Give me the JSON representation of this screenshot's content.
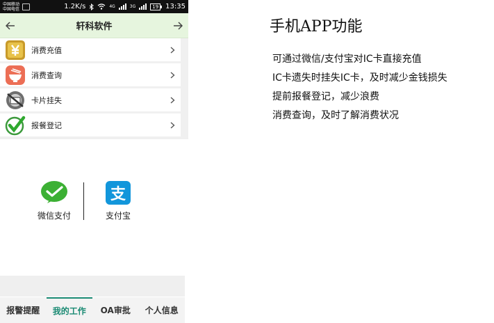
{
  "status_bar": {
    "carrier_1": "中国移动",
    "carrier_2": "中国电信",
    "speed": "1.2K/s",
    "network_1": "4G",
    "network_2": "3G",
    "battery": "19",
    "time": "13:35"
  },
  "app": {
    "title": "轩科软件",
    "menu": [
      {
        "label": "消费充值",
        "icon": "yuan-coin-icon"
      },
      {
        "label": "消费查询",
        "icon": "rice-bowl-icon"
      },
      {
        "label": "卡片挂失",
        "icon": "lost-card-icon"
      },
      {
        "label": "报餐登记",
        "icon": "check-mark-icon"
      }
    ]
  },
  "payment": {
    "wechat": "微信支付",
    "alipay": "支付宝",
    "alipay_glyph": "支",
    "wechat_color": "#3cb034",
    "alipay_color": "#1296db"
  },
  "tabs": [
    "报警提醒",
    "我的工作",
    "OA审批",
    "个人信息"
  ],
  "active_tab": 1,
  "feature": {
    "title": "手机APP功能",
    "lines": [
      "可通过微信/支付宝对IC卡直接充值",
      "IC卡遗失时挂失IC卡，及时减少金钱损失",
      "提前报餐登记，减少浪费",
      "消费查询，及时了解消费状况"
    ]
  },
  "colors": {
    "header_bg": "#e6f5de",
    "accent": "#1a8a73"
  }
}
